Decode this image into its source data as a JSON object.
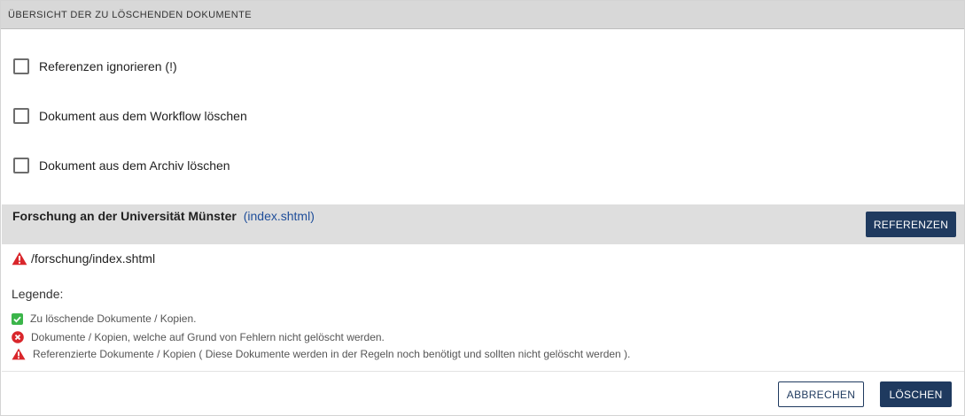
{
  "header": {
    "title": "ÜBERSICHT DER ZU LÖSCHENDEN DOKUMENTE"
  },
  "options": [
    {
      "label": "Referenzen ignorieren (!)",
      "checked": false
    },
    {
      "label": "Dokument aus dem Workflow löschen",
      "checked": false
    },
    {
      "label": "Dokument aus dem Archiv löschen",
      "checked": false
    }
  ],
  "document": {
    "title": "Forschung an der Universität Münster",
    "link": "(index.shtml)",
    "references_button": "REFERENZEN",
    "path": "/forschung/index.shtml",
    "path_icon": "warning-icon"
  },
  "legend": {
    "title": "Legende:",
    "items": [
      {
        "icon": "check-icon",
        "text": "Zu löschende Dokumente / Kopien."
      },
      {
        "icon": "error-icon",
        "text": "Dokumente / Kopien, welche auf Grund von Fehlern nicht gelöscht werden."
      },
      {
        "icon": "warning-icon",
        "text": "Referenzierte Dokumente / Kopien ( Diese Dokumente werden in der Regeln noch benötigt und sollten nicht gelöscht werden )."
      }
    ]
  },
  "footer": {
    "cancel_label": "ABBRECHEN",
    "delete_label": "LÖSCHEN"
  },
  "colors": {
    "primary": "#1f3a5f",
    "link": "#1f4e9a",
    "success": "#3bb54a",
    "error": "#d9262b",
    "warning": "#d9262b"
  }
}
